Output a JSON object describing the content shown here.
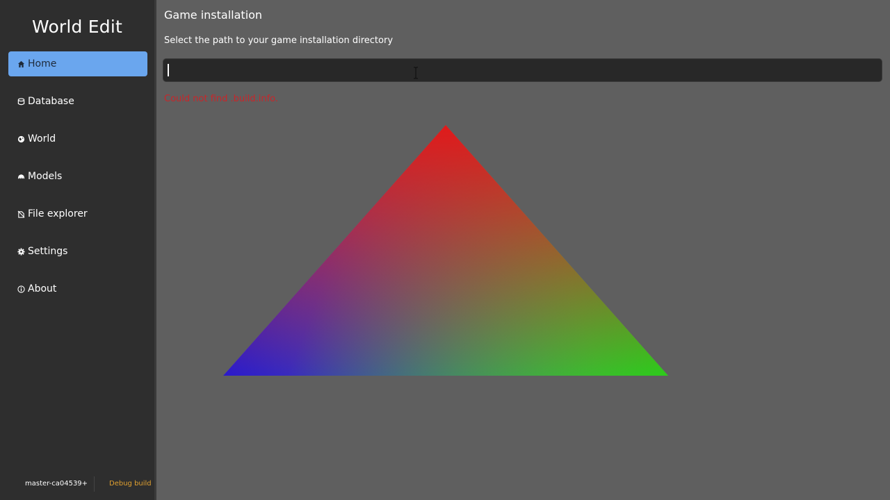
{
  "app": {
    "title": "World Edit"
  },
  "sidebar": {
    "items": [
      {
        "label": "Home",
        "icon": "home-icon",
        "active": true
      },
      {
        "label": "Database",
        "icon": "database-icon",
        "active": false
      },
      {
        "label": "World",
        "icon": "world-icon",
        "active": false
      },
      {
        "label": "Models",
        "icon": "models-icon",
        "active": false
      },
      {
        "label": "File explorer",
        "icon": "file-explorer-icon",
        "active": false
      },
      {
        "label": "Settings",
        "icon": "gear-icon",
        "active": false
      },
      {
        "label": "About",
        "icon": "info-icon",
        "active": false
      }
    ],
    "footer": {
      "version": "master-ca04539+",
      "build": "Debug build"
    }
  },
  "main": {
    "section_title": "Game installation",
    "description": "Select the path to your game installation directory",
    "path_input": {
      "value": "",
      "placeholder": ""
    },
    "error": "Could not find .build.info."
  },
  "colors": {
    "accent": "#6aa6ee",
    "error": "#c8262a",
    "build_label": "#e0a030",
    "triangle_top": "#e01a1a",
    "triangle_left": "#2a1acc",
    "triangle_right": "#2ccc1a"
  }
}
